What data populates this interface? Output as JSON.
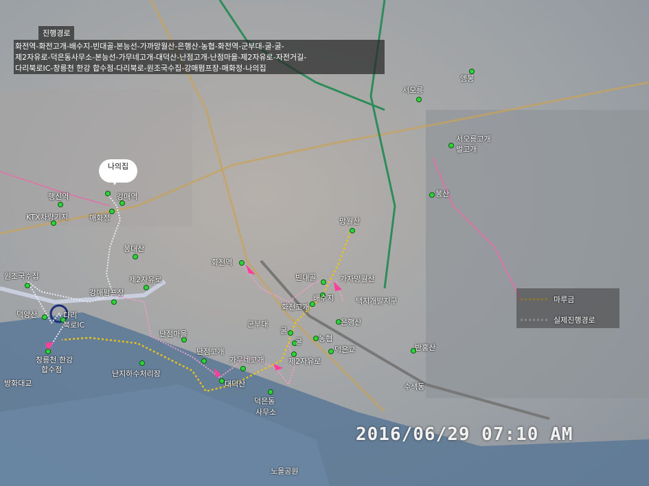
{
  "route": {
    "title": "진행경로",
    "lines": [
      "화전역-화전고개-배수지-빈대골-본능선-가까망월산-은행산-농협-화전역-군부대-굴-굴-",
      "제2자유로-덕은동사무소-본능선-가무네고개-대덕산-난점고개-난점마을-제2자유로-자전거길-",
      "다리북로IC-창릉천 한강 합수점-다리북로-원조국수집-강매펌프장-매화정-나의집"
    ]
  },
  "callout": {
    "label": "나의집"
  },
  "places": {
    "haengsin": "행신역",
    "gangmae": "강매역",
    "ktx": "KTX차량기지",
    "maehwa": "매화정",
    "bongdae": "봉대산",
    "jae2a": "제2자유로",
    "pump": "강매펌프장",
    "wonjo": "원조국수집",
    "deokyang": "덕양산",
    "dari": "다리",
    "bukro": "북로IC",
    "hapsu1": "창릉천 한강",
    "hapsu2": "합수점",
    "banghwa": "방화대교",
    "nanji": "난지하수처리장",
    "nanjeom_maeul": "난점마을",
    "nanjeom_gogae": "난점고개",
    "daedeok": "대덕산",
    "gamune": "가무네고개",
    "jae2b": "제2자유로",
    "deokeun1": "덕은동",
    "deokeun2": "사무소",
    "hwajeon_st": "화전역",
    "gunbu": "군부대",
    "gul1": "굴",
    "gul2": "굴",
    "nonghyup": "농협",
    "deokeungyo": "덕은교",
    "eunhaeng": "은행산",
    "hwajeon_gogae": "화전고개",
    "baesuji": "배수지",
    "bindae": "빈대골",
    "gamja": "가자망월산",
    "mangwol": "망월산",
    "taekji": "택지개발지구",
    "seooreung": "서오릉",
    "aengbong": "앵봉",
    "seooreung_gogae1": "서오릉고개",
    "seooreung_gogae2": "벌고개",
    "bongsan": "봉산",
    "banhong": "반홍산",
    "susaek": "수색동",
    "noeul": "노을공원"
  },
  "legend": {
    "trail": "마루금",
    "actual": "실제진행경로"
  },
  "timestamp": "2016/06/29  07:10  AM",
  "colors": {
    "trail": "#e8c21a",
    "actual": "#e6e6f0",
    "poi": "#2fd43a",
    "water": "#4a6f96",
    "road": "#c9a25a"
  }
}
